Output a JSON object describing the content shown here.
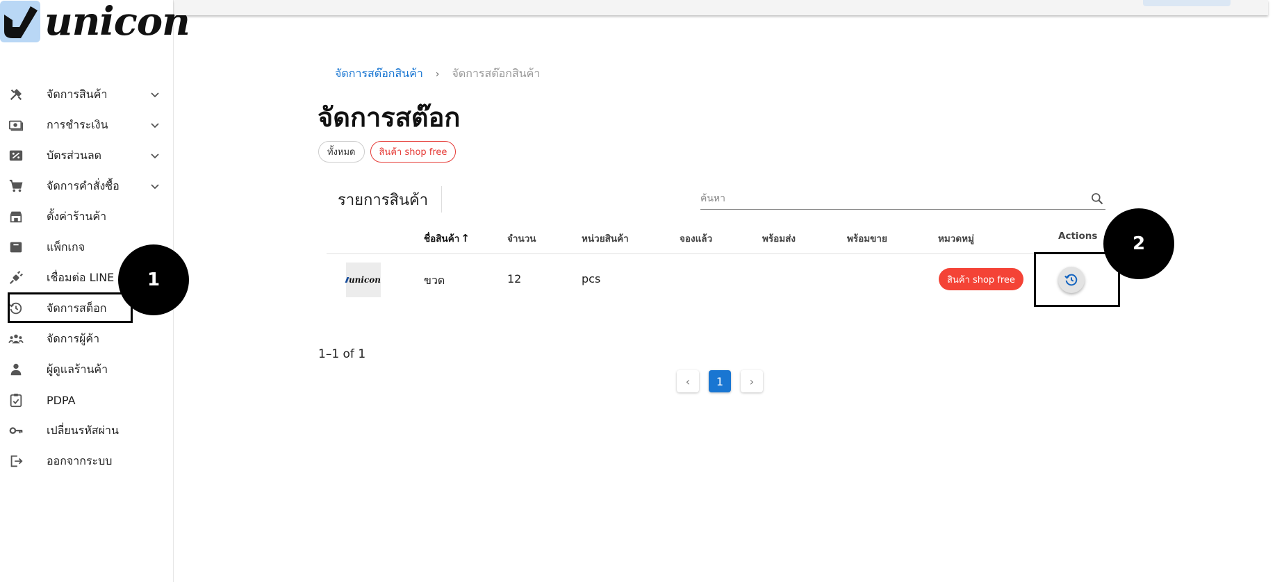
{
  "logo": {
    "text": "unicon"
  },
  "sidebar": {
    "items": [
      {
        "label": "จัดการสินค้า",
        "icon": "tools-icon",
        "expandable": true
      },
      {
        "label": "การชำระเงิน",
        "icon": "payment-icon",
        "expandable": true
      },
      {
        "label": "บัตรส่วนลด",
        "icon": "discount-icon",
        "expandable": true
      },
      {
        "label": "จัดการคำสั่งซื้อ",
        "icon": "cart-icon",
        "expandable": true
      },
      {
        "label": "ตั้งค่าร้านค้า",
        "icon": "store-icon",
        "expandable": false
      },
      {
        "label": "แพ็กเกจ",
        "icon": "package-icon",
        "expandable": false
      },
      {
        "label": "เชื่อมต่อ LINE",
        "icon": "plug-icon",
        "expandable": false
      },
      {
        "label": "จัดการสต็อก",
        "icon": "history-icon",
        "expandable": false
      },
      {
        "label": "จัดการผู้ค้า",
        "icon": "group-icon",
        "expandable": false
      },
      {
        "label": "ผู้ดูแลร้านค้า",
        "icon": "person-icon",
        "expandable": false
      },
      {
        "label": "PDPA",
        "icon": "clipboard-icon",
        "expandable": false
      },
      {
        "label": "เปลี่ยนรหัสผ่าน",
        "icon": "key-icon",
        "expandable": false
      },
      {
        "label": "ออกจากระบบ",
        "icon": "logout-icon",
        "expandable": false
      }
    ]
  },
  "markers": {
    "one": "1",
    "two": "2"
  },
  "breadcrumb": {
    "link": "จัดการสต๊อกสินค้า",
    "separator": "›",
    "current": "จัดการสต๊อกสินค้า"
  },
  "page": {
    "title": "จัดการสต๊อก"
  },
  "filters": {
    "all": "ทั้งหมด",
    "shop_free": "สินค้า shop free"
  },
  "list": {
    "title": "รายการสินค้า"
  },
  "search": {
    "placeholder": "ค้นหา"
  },
  "table": {
    "headers": {
      "name": "ชื่อสินค้า",
      "qty": "จำนวน",
      "unit": "หน่วยสินค้า",
      "reserved": "จองแล้ว",
      "ready_ship": "พร้อมส่ง",
      "ready_sell": "พร้อมขาย",
      "category": "หมวดหมู่",
      "actions": "Actions"
    },
    "sort_indicator": "↑",
    "rows": [
      {
        "thumb_text": "unicon",
        "name": "ขวด",
        "qty": "12",
        "unit": "pcs",
        "reserved": "",
        "ready_ship": "",
        "ready_sell": "",
        "category": "สินค้า shop free"
      }
    ]
  },
  "pagination": {
    "info": "1–1 of 1",
    "prev": "‹",
    "page": "1",
    "next": "›"
  },
  "colors": {
    "accent": "#1976d2",
    "danger": "#f44336",
    "logo_bg": "#b9d7f5"
  }
}
